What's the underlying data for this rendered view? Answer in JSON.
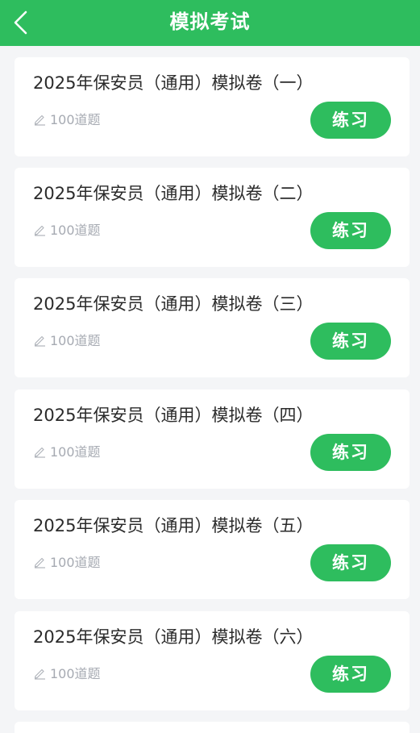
{
  "header": {
    "title": "模拟考试",
    "back_icon": "chevron-left-icon"
  },
  "exams": [
    {
      "title": "2025年保安员（通用）模拟卷（一）",
      "count": "100道题",
      "button": "练习"
    },
    {
      "title": "2025年保安员（通用）模拟卷（二）",
      "count": "100道题",
      "button": "练习"
    },
    {
      "title": "2025年保安员（通用）模拟卷（三）",
      "count": "100道题",
      "button": "练习"
    },
    {
      "title": "2025年保安员（通用）模拟卷（四）",
      "count": "100道题",
      "button": "练习"
    },
    {
      "title": "2025年保安员（通用）模拟卷（五）",
      "count": "100道题",
      "button": "练习"
    },
    {
      "title": "2025年保安员（通用）模拟卷（六）",
      "count": "100道题",
      "button": "练习"
    }
  ],
  "colors": {
    "primary": "#2ebd5e",
    "background": "#f4f5f7",
    "title_text": "#2b2b2b",
    "meta_text": "#a6aab2"
  }
}
